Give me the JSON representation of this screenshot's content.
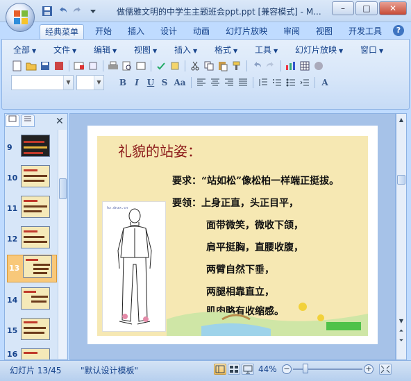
{
  "window": {
    "title": "做儒雅文明的中学生主题班会ppt.ppt [兼容模式] - M...",
    "min_label": "–",
    "max_label": "□",
    "close_label": "✕"
  },
  "ribbon_tabs": [
    "经典菜单",
    "开始",
    "插入",
    "设计",
    "动画",
    "幻灯片放映",
    "审阅",
    "视图",
    "开发工具"
  ],
  "help_label": "?",
  "classic_menu": [
    "全部",
    "文件",
    "编辑",
    "视图",
    "插入",
    "格式",
    "工具",
    "幻灯片放映",
    "窗口"
  ],
  "format_buttons": [
    "B",
    "I",
    "U",
    "S",
    "Aa"
  ],
  "font_color_label": "A",
  "slides_panel": {
    "tabs": [
      "slides-tab-icon",
      "outline-tab-icon"
    ],
    "close": "✕",
    "slides": [
      {
        "number": "9"
      },
      {
        "number": "10"
      },
      {
        "number": "11"
      },
      {
        "number": "12"
      },
      {
        "number": "13"
      },
      {
        "number": "14"
      },
      {
        "number": "15"
      },
      {
        "number": "16"
      }
    ],
    "selected": "13"
  },
  "slide": {
    "title": "礼貌的站姿：",
    "requirement": "要求：“站如松”像松柏一样端正挺拔。",
    "points": [
      "要领：上身正直，头正目平，",
      "面带微笑，微收下颌，",
      "肩平挺胸，直腰收腹，",
      "两臂自然下垂，",
      "两腿相靠直立，",
      "肌肉略有收缩感。"
    ],
    "figure_caption": "hz.dnzx.cn"
  },
  "status": {
    "slide_info": "幻灯片 13/45",
    "template": "\"默认设计模板\"",
    "zoom": "44%",
    "zoom_minus": "−",
    "zoom_plus": "+"
  }
}
